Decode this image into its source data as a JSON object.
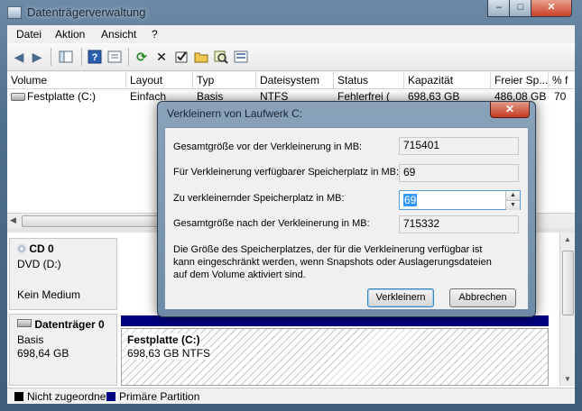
{
  "window": {
    "title": "Datenträgerverwaltung",
    "min": "–",
    "max": "□",
    "close": "✕"
  },
  "menu": [
    "Datei",
    "Aktion",
    "Ansicht",
    "?"
  ],
  "columns": [
    "Volume",
    "Layout",
    "Typ",
    "Dateisystem",
    "Status",
    "Kapazität",
    "Freier Sp...",
    "% f"
  ],
  "volumes": [
    {
      "volume": "Festplatte (C:)",
      "layout": "Einfach",
      "typ": "Basis",
      "fs": "NTFS",
      "status": "Fehlerfrei (",
      "capacity": "698,63 GB",
      "free": "486,08 GB",
      "pct": "70"
    }
  ],
  "disks": {
    "cd": {
      "name": "CD 0",
      "type": "DVD (D:)",
      "state": "Kein Medium"
    },
    "disk0": {
      "name": "Datenträger 0",
      "type": "Basis",
      "size": "698,64 GB"
    },
    "partition": {
      "name": "Festplatte  (C:)",
      "detail": "698,63 GB NTFS"
    }
  },
  "legend": {
    "unallocated": "Nicht zugeordnet",
    "primary": "Primäre Partition"
  },
  "colors": {
    "unallocated": "#000000",
    "primary": "#00007f",
    "accent": "#3399ff"
  },
  "dialog": {
    "title": "Verkleinern von Laufwerk C:",
    "total_before_label": "Gesamtgröße vor der Verkleinerung in MB:",
    "total_before_value": "715401",
    "available_label": "Für Verkleinerung verfügbarer Speicherplatz in MB:",
    "available_value": "69",
    "shrink_label": "Zu verkleinernder Speicherplatz in MB:",
    "shrink_value": "69",
    "total_after_label": "Gesamtgröße nach der Verkleinerung in MB:",
    "total_after_value": "715332",
    "info_line1": "Die Größe des Speicherplatzes, der für die Verkleinerung verfügbar ist",
    "info_line2": "kann eingeschränkt werden, wenn Snapshots oder Auslagerungsdateien",
    "info_line3": "auf dem Volume aktiviert sind.",
    "shrink_button": "Verkleinern",
    "cancel_button": "Abbrechen",
    "close": "✕"
  }
}
